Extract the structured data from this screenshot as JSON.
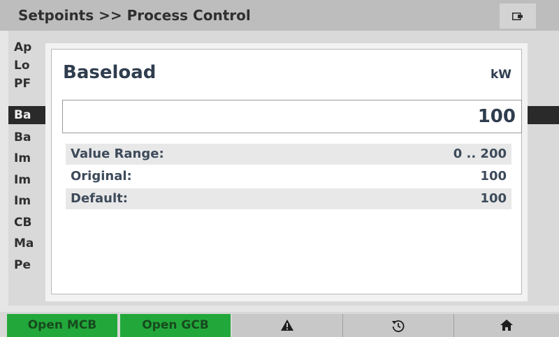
{
  "header": {
    "title": "Setpoints >> Process Control",
    "status_icon": "battery-icon"
  },
  "list": {
    "rows": [
      {
        "label": "Ap"
      },
      {
        "label": "Lo"
      },
      {
        "label": "PF"
      },
      {
        "label": "Ba",
        "selected": true
      },
      {
        "label": "Ba"
      },
      {
        "label": "Im"
      },
      {
        "label": "Im"
      },
      {
        "label": "Im"
      },
      {
        "label": "CB"
      },
      {
        "label": "Ma"
      },
      {
        "label": "Pe"
      }
    ]
  },
  "dialog": {
    "title": "Baseload",
    "unit": "kW",
    "value": "100",
    "info": [
      {
        "label": "Value Range:",
        "value": "0 .. 200"
      },
      {
        "label": "Original:",
        "value": "100"
      },
      {
        "label": "Default:",
        "value": "100"
      }
    ]
  },
  "footer": {
    "buttons": [
      {
        "label": "Open MCB",
        "style": "green"
      },
      {
        "label": "Open GCB",
        "style": "green"
      },
      {
        "icon": "alarm-warning-icon"
      },
      {
        "icon": "history-icon"
      },
      {
        "icon": "home-icon"
      }
    ]
  },
  "colors": {
    "header": "#bdbdbd",
    "selected_row": "#2a2a2a",
    "green_button": "#22a83a",
    "dialog_text": "#2f3d4e"
  }
}
